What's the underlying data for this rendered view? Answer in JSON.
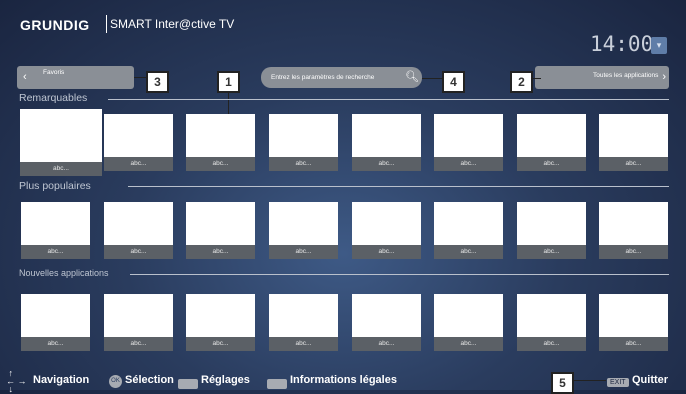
{
  "header": {
    "logo": "GRUNDIG",
    "app_title": "SMART Inter@ctive TV",
    "clock": "14:00",
    "clock_icon": "wifi-icon"
  },
  "nav": {
    "favorites": "Favoris",
    "all_apps": "Toutes les applications",
    "search_placeholder": "Entrez les paramètres de recherche"
  },
  "callouts": {
    "c1": "1",
    "c2": "2",
    "c3": "3",
    "c4": "4",
    "c5": "5"
  },
  "sections": [
    {
      "title": "Remarquables"
    },
    {
      "title": "Plus populaires"
    },
    {
      "title": "Nouvelles applications"
    }
  ],
  "tile_caption": "abc...",
  "footer": {
    "navigation": "Navigation",
    "ok": "OK",
    "selection": "Sélection",
    "settings": "Réglages",
    "legal": "Informations légales",
    "exit_key": "EXIT",
    "quit": "Quitter"
  }
}
